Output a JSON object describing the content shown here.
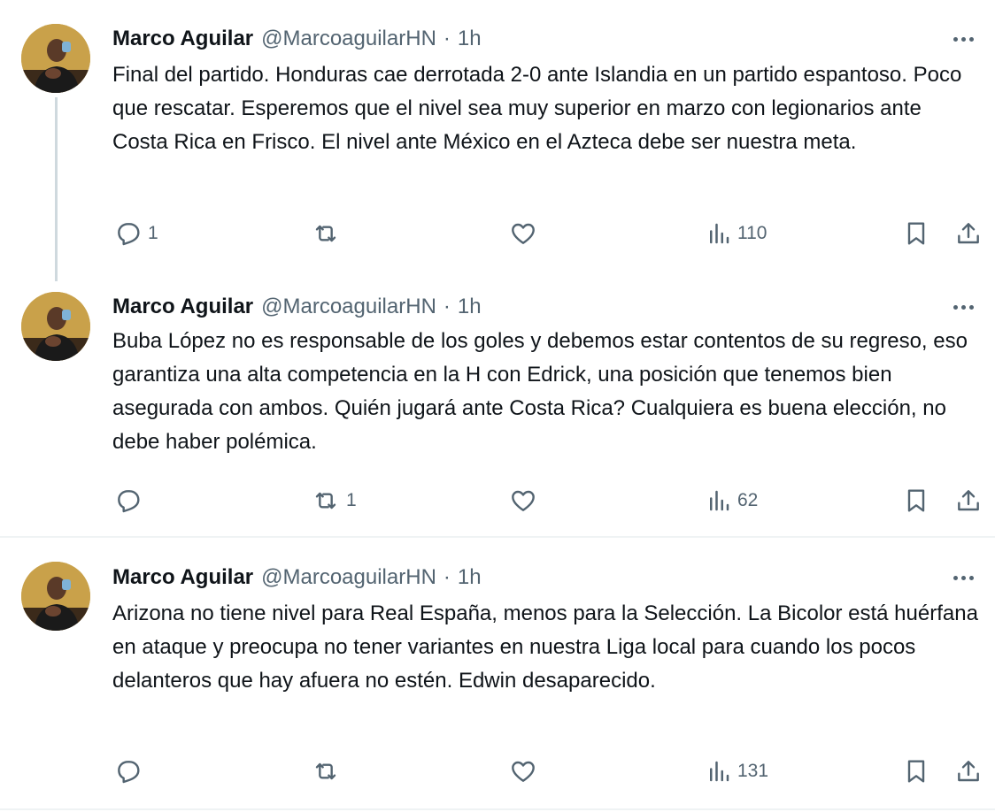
{
  "tweets": [
    {
      "author": {
        "name": "Marco Aguilar",
        "handle": "@MarcoaguilarHN"
      },
      "separator": "·",
      "time": "1h",
      "text": "Final del partido. Honduras cae derrotada 2-0 ante Islandia en un partido espantoso. Poco que rescatar. Esperemos que el nivel sea muy superior en marzo con legionarios ante Costa Rica en Frisco. El nivel ante México en el Azteca debe ser nuestra meta.",
      "replies": "1",
      "reposts": "",
      "likes": "",
      "views": "110"
    },
    {
      "author": {
        "name": "Marco Aguilar",
        "handle": "@MarcoaguilarHN"
      },
      "separator": "·",
      "time": "1h",
      "text": "Buba López no es responsable de los goles y debemos estar contentos de su regreso, eso garantiza una alta competencia en la H con Edrick, una posición que tenemos bien asegurada con ambos. Quién jugará ante Costa Rica? Cualquiera es buena elección, no debe haber polémica.",
      "replies": "",
      "reposts": "1",
      "likes": "",
      "views": "62"
    },
    {
      "author": {
        "name": "Marco Aguilar",
        "handle": "@MarcoaguilarHN"
      },
      "separator": "·",
      "time": "1h",
      "text": "Arizona no tiene nivel para Real España, menos para la Selección. La Bicolor está huérfana en ataque y preocupa no tener variantes en nuestra Liga local para cuando los pocos delanteros que hay afuera no estén. Edwin desaparecido.",
      "replies": "",
      "reposts": "",
      "likes": "",
      "views": "131"
    }
  ],
  "colors": {
    "text": "#0f1419",
    "secondary": "#536471",
    "divider": "#eff3f4",
    "thread_line": "#cfd9de"
  },
  "icons": [
    "reply-icon",
    "repost-icon",
    "like-icon",
    "views-icon",
    "bookmark-icon",
    "share-icon",
    "more-icon"
  ]
}
